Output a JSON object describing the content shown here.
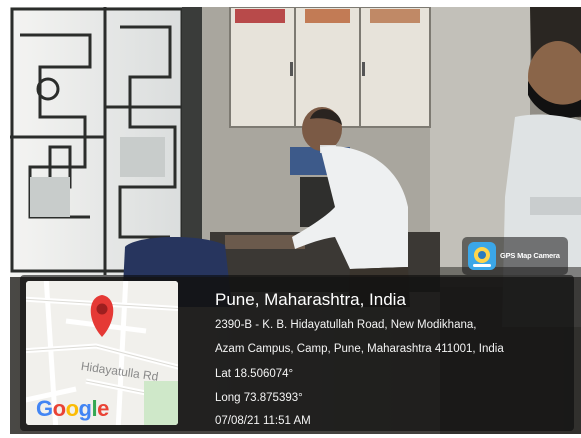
{
  "app_badge": {
    "label": "GPS Map Camera",
    "icon": "gps-map-camera-icon"
  },
  "map": {
    "road_label": "Hidayatulla Rd",
    "logo_text": "Google",
    "logo_colors": [
      "#4285F4",
      "#EA4335",
      "#FBBC05",
      "#4285F4",
      "#34A853",
      "#EA4335"
    ],
    "marker_color": "#E53935",
    "marker_icon": "location-pin-icon"
  },
  "location": {
    "title": "Pune, Maharashtra, India",
    "address_line1": "2390-B - K. B. Hidayatullah Road, New Modikhana,",
    "address_line2": "Azam Campus, Camp, Pune, Maharashtra 411001, India",
    "latitude": "Lat 18.506074°",
    "longitude": "Long 73.875393°",
    "datetime": "07/08/21 11:51 AM"
  }
}
